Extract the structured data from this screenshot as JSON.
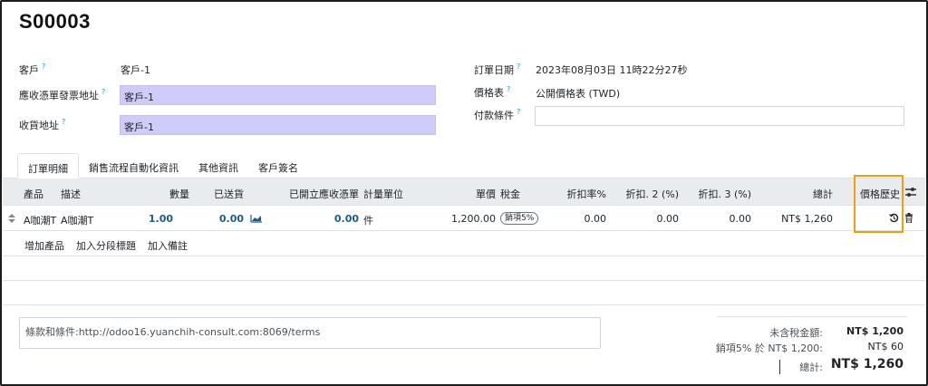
{
  "order": {
    "name": "S00003"
  },
  "left_fields": {
    "customer_label": "客戶",
    "customer_value": "客戶-1",
    "invoice_addr_label": "應收憑單發票地址",
    "invoice_addr_value": "客戶-1",
    "delivery_addr_label": "收貨地址",
    "delivery_addr_value": "客戶-1"
  },
  "right_fields": {
    "order_date_label": "訂單日期",
    "order_date_value": "2023年08月03日 11時22分27秒",
    "pricelist_label": "價格表",
    "pricelist_value": "公開價格表 (TWD)",
    "payment_terms_label": "付款條件",
    "payment_terms_value": ""
  },
  "help_mark": "?",
  "tabs": [
    {
      "label": "訂單明細"
    },
    {
      "label": "銷售流程自動化資訊"
    },
    {
      "label": "其他資訊"
    },
    {
      "label": "客戶簽名"
    }
  ],
  "columns": {
    "product": "產品",
    "description": "描述",
    "quantity": "數量",
    "delivered": "已送貨",
    "invoiced": "已開立應收憑單",
    "uom": "計量單位",
    "unit_price": "單價",
    "taxes": "稅金",
    "discount_pct": "折扣率%",
    "discount2": "折扣. 2 (%)",
    "discount3": "折扣. 3 (%)",
    "subtotal": "總計",
    "price_history": "價格歷史"
  },
  "lines": [
    {
      "product": "A咖潮T",
      "description": "A咖潮T",
      "quantity": "1.00",
      "delivered": "0.00",
      "invoiced": "0.00",
      "uom": "件",
      "unit_price": "1,200.00",
      "tax": "銷項5%",
      "discount_pct": "0.00",
      "discount2": "0.00",
      "discount3": "0.00",
      "subtotal": "NT$ 1,260"
    }
  ],
  "add_links": {
    "add_product": "增加產品",
    "add_section": "加入分段標題",
    "add_note": "加入備註"
  },
  "terms": "條款和條件:http://odoo16.yuanchih-consult.com:8069/terms",
  "totals": {
    "untaxed_label": "未含稅金額:",
    "untaxed_value": "NT$ 1,200",
    "tax_label": "銷項5% 於 NT$ 1,200:",
    "tax_value": "NT$ 60",
    "total_label": "總計:",
    "total_value": "NT$ 1,260"
  },
  "colors": {
    "highlight_field": "#cfccf9",
    "link_number": "#1b5c8f",
    "annotation_box": "#f39c12",
    "help_mark": "#17a2b8"
  }
}
